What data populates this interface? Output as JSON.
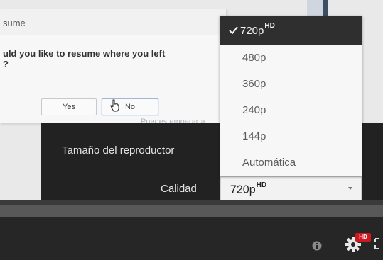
{
  "resume_dialog": {
    "title": "sume",
    "question": "uld you like to resume where you left",
    "question_2": "?",
    "yes_label": "Yes",
    "no_label": "No",
    "ghost_text": "Puedes emperar a"
  },
  "settings": {
    "size_label": "Tamaño del reproductor",
    "quality_label": "Calidad",
    "quality_value": "720p",
    "quality_value_badge": "HD"
  },
  "quality_menu": {
    "selected_label": "720p",
    "selected_badge": "HD",
    "items": [
      "480p",
      "360p",
      "240p",
      "144p",
      "Automática"
    ]
  },
  "controls": {
    "hd_badge": "HD"
  },
  "icons": {
    "check": "check-icon",
    "select_arrow": "chevron-down-icon",
    "info": "info-icon",
    "gear": "gear-icon",
    "fullscreen": "fullscreen-icon",
    "cursor": "hand-cursor-icon"
  },
  "colors": {
    "selected_item_bg": "#2f2f2f",
    "menu_bg": "#f7f7f7",
    "panel_bg": "#1b1b1b",
    "hd_badge": "#cc181e"
  }
}
